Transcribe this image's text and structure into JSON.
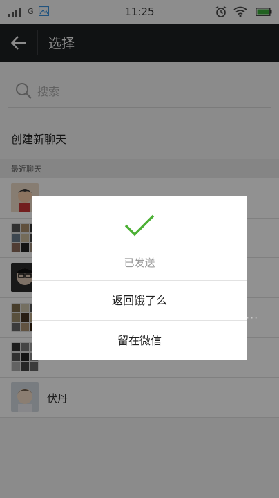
{
  "status_bar": {
    "carrier": "G",
    "time": "11:25"
  },
  "app_bar": {
    "title": "选择"
  },
  "search": {
    "placeholder": "搜索"
  },
  "create_chat_label": "创建新聊天",
  "section_header": "最近聊天",
  "recent_chats": [
    {
      "name": ""
    },
    {
      "name": ""
    },
    {
      "name": ""
    },
    {
      "name": ""
    },
    {
      "name": ""
    },
    {
      "name": "伏丹"
    }
  ],
  "dialog": {
    "status_text": "已发送",
    "return_button": "返回饿了么",
    "stay_button": "留在微信"
  },
  "colors": {
    "accent_green": "#4cb035",
    "app_bar_bg": "#1d1f21",
    "battery_green": "#3aa83a"
  }
}
